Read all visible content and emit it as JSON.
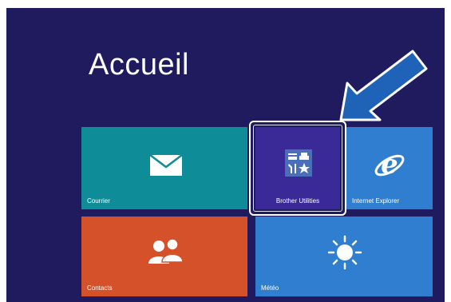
{
  "start_screen": {
    "title": "Accueil",
    "background": "#201a5e"
  },
  "tiles": {
    "courrier": {
      "label": "Courrier",
      "icon": "mail-icon",
      "color": "#0e8c97"
    },
    "brother_utilities": {
      "label": "Brother Utilities",
      "icon": "brother-utilities-icon",
      "color": "#3a2a98",
      "selected": true
    },
    "internet_explorer": {
      "label": "Internet Explorer",
      "icon": "internet-explorer-icon",
      "color": "#2f7ecf"
    },
    "contacts": {
      "label": "Contacts",
      "icon": "people-icon",
      "color": "#d4512a"
    },
    "meteo": {
      "label": "Météo",
      "icon": "sun-icon",
      "color": "#2f7ecf"
    }
  },
  "annotation": {
    "icon": "pointer-arrow-icon",
    "color": "#1e63b8"
  }
}
